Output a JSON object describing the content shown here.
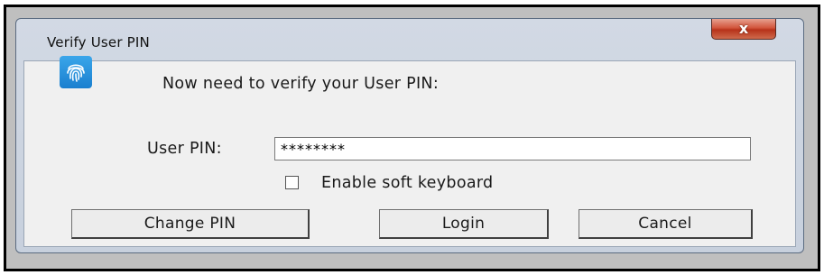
{
  "window": {
    "title": "Verify User PIN",
    "close_label": "x"
  },
  "dialog": {
    "prompt": "Now need to verify your User PIN:",
    "pin_label": "User PIN:",
    "pin_value": "********",
    "soft_keyboard_label": "Enable soft keyboard",
    "soft_keyboard_checked": false
  },
  "buttons": {
    "change_pin": "Change PIN",
    "login": "Login",
    "cancel": "Cancel"
  },
  "icons": {
    "app": "fingerprint-icon",
    "close": "close-icon"
  },
  "colors": {
    "icon_bg": "#1a7fcf",
    "close_button": "#c8442a",
    "client_bg": "#f0f0f0",
    "frame_bg": "#c7d0dd"
  }
}
